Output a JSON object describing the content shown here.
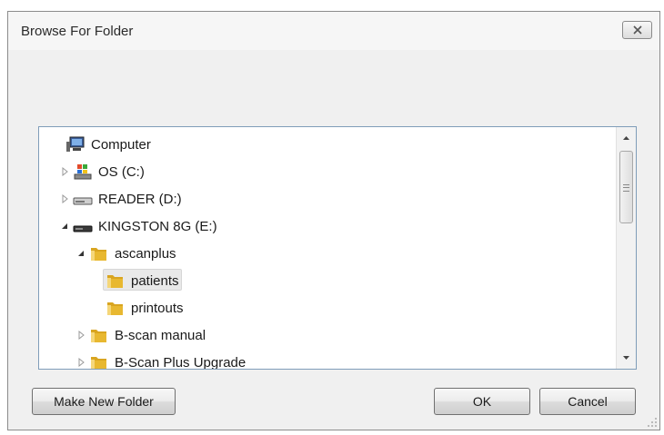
{
  "window": {
    "title": "Browse For Folder",
    "close_icon": "close-icon"
  },
  "tree": {
    "items": [
      {
        "label": "Computer",
        "icon": "computer-icon",
        "level": 0,
        "expander": "none",
        "selected": false
      },
      {
        "label": "OS (C:)",
        "icon": "system-drive-icon",
        "level": 1,
        "expander": "collapsed",
        "selected": false
      },
      {
        "label": "READER (D:)",
        "icon": "drive-icon",
        "level": 1,
        "expander": "collapsed",
        "selected": false
      },
      {
        "label": "KINGSTON 8G (E:)",
        "icon": "usb-drive-icon",
        "level": 1,
        "expander": "expanded",
        "selected": false
      },
      {
        "label": "ascanplus",
        "icon": "folder-icon",
        "level": 2,
        "expander": "expanded",
        "selected": false
      },
      {
        "label": "patients",
        "icon": "folder-icon",
        "level": 3,
        "expander": "none",
        "selected": true
      },
      {
        "label": "printouts",
        "icon": "folder-icon",
        "level": 3,
        "expander": "none",
        "selected": false
      },
      {
        "label": "B-scan manual",
        "icon": "folder-icon",
        "level": 2,
        "expander": "collapsed",
        "selected": false
      },
      {
        "label": "B-Scan Plus Upgrade",
        "icon": "folder-icon",
        "level": 2,
        "expander": "collapsed",
        "selected": false
      }
    ]
  },
  "buttons": {
    "make_new_folder": "Make New Folder",
    "ok": "OK",
    "cancel": "Cancel"
  },
  "colors": {
    "dialog_bg": "#f0f0f0",
    "tree_border": "#7f9db9",
    "folder": "#e8b830",
    "selection": "#e9e9e9"
  }
}
